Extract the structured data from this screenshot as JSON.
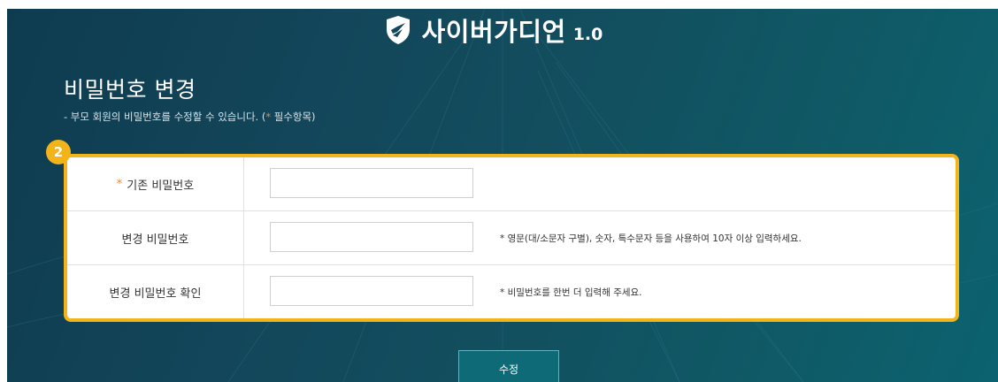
{
  "brand": {
    "name": "사이버가디언",
    "version": "1.0"
  },
  "page": {
    "title": "비밀번호 변경",
    "description_prefix": "- 부모 회원의 비밀번호를 수정할 수 있습니다. (",
    "required_mark": "*",
    "description_suffix": " 필수항목)"
  },
  "step_badge": "2",
  "form": {
    "rows": [
      {
        "required_mark": "*",
        "label": "기존 비밀번호",
        "value": "",
        "hint": ""
      },
      {
        "label": "변경 비밀번호",
        "value": "",
        "hint": "* 영문(대/소문자 구별), 숫자, 특수문자 등을 사용하여 10자 이상 입력하세요."
      },
      {
        "label": "변경 비밀번호 확인",
        "value": "",
        "hint": "* 비밀번호를 한번 더 입력해 주세요."
      }
    ]
  },
  "submit_label": "수정",
  "colors": {
    "highlight": "#f2b418",
    "required": "#f08a2a",
    "button": "#0f6a78"
  }
}
